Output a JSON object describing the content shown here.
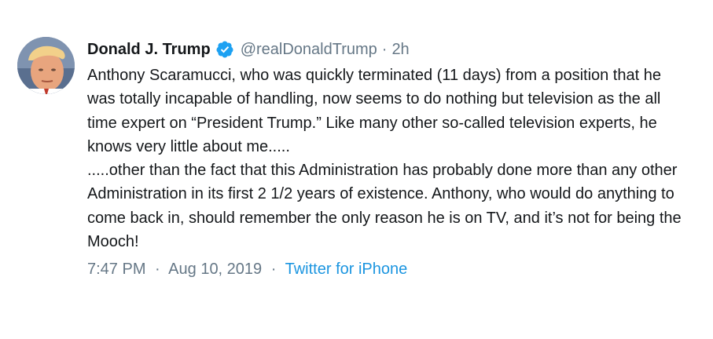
{
  "tweet": {
    "display_name": "Donald J. Trump",
    "handle": "@realDonaldTrump",
    "separator": "·",
    "relative_time": "2h",
    "verified_icon": "verified-badge-icon",
    "avatar_icon": "profile-photo",
    "paragraphs": [
      "Anthony Scaramucci, who was quickly terminated (11 days) from a position that he was totally incapable of handling, now seems to do nothing but television as the all time expert on “President Trump.” Like many other so-called television experts, he knows very little about me.....",
      ".....other than the fact that this Administration has probably done more than any other Administration in its first 2 1/2 years of existence. Anthony, who would do anything to come back in, should remember the only reason he is on TV, and it’s not for being the Mooch!"
    ],
    "time": "7:47 PM",
    "date": "Aug 10, 2019",
    "source": "Twitter for iPhone"
  },
  "colors": {
    "name": "#14171a",
    "secondary": "#657786",
    "link": "#1b95e0",
    "verified": "#1da1f2",
    "background": "#ffffff"
  }
}
